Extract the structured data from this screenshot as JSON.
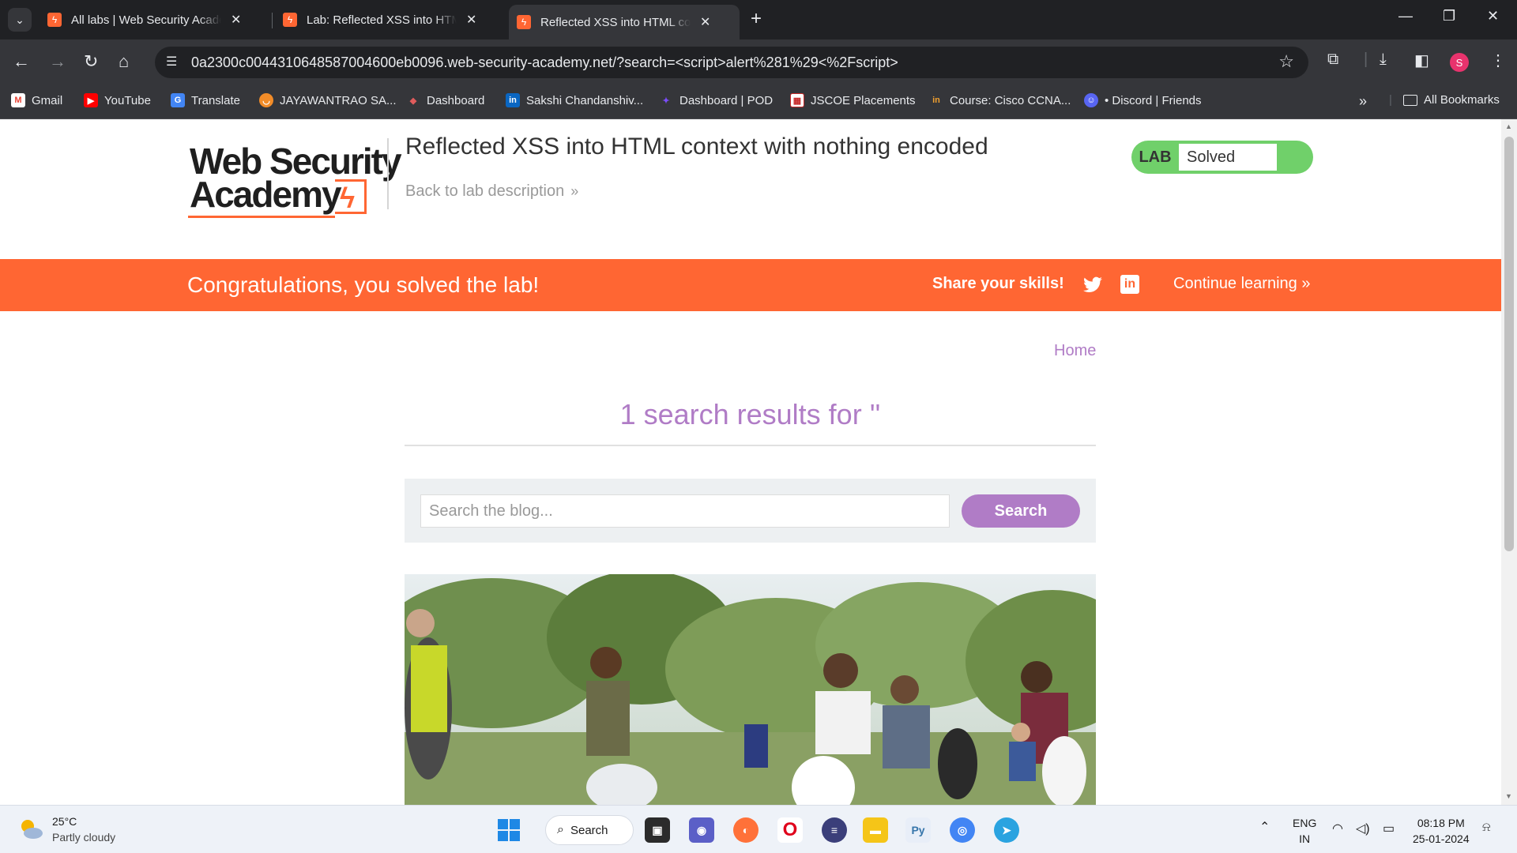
{
  "browser": {
    "tabs": [
      {
        "title": "All labs | Web Security Academy"
      },
      {
        "title": "Lab: Reflected XSS into HTML context with nothing encoded"
      },
      {
        "title": "Reflected XSS into HTML context with nothing encoded",
        "active": true
      }
    ],
    "url": "0a2300c0044310648587004600eb0096.web-security-academy.net/?search=<script>alert%281%29<%2Fscript>",
    "profile_initial": "S",
    "bookmarks": [
      {
        "label": "Gmail"
      },
      {
        "label": "YouTube"
      },
      {
        "label": "Translate"
      },
      {
        "label": "JAYAWANTRAO SA..."
      },
      {
        "label": "Dashboard"
      },
      {
        "label": "Sakshi Chandanshiv..."
      },
      {
        "label": "Dashboard | POD"
      },
      {
        "label": "JSCOE Placements"
      },
      {
        "label": "Course: Cisco CCNA..."
      },
      {
        "label": "• Discord | Friends"
      }
    ],
    "all_bookmarks": "All Bookmarks"
  },
  "header": {
    "logo_line1": "Web Security",
    "logo_line2": "Academy",
    "lab_title": "Reflected XSS into HTML context with nothing encoded",
    "back_link": "Back to lab description",
    "lab_badge_label": "LAB",
    "lab_status": "Solved"
  },
  "banner": {
    "message": "Congratulations, you solved the lab!",
    "share": "Share your skills!",
    "continue": "Continue learning"
  },
  "main": {
    "home_link": "Home",
    "results_title": "1 search results for ''",
    "search_placeholder": "Search the blog...",
    "search_button": "Search"
  },
  "taskbar": {
    "temperature": "25°C",
    "condition": "Partly cloudy",
    "search": "Search",
    "lang_line1": "ENG",
    "lang_line2": "IN",
    "time": "08:18 PM",
    "date": "25-01-2024"
  },
  "colors": {
    "accent_orange": "#ff6633",
    "purple": "#b07cc6",
    "lab_green": "#70d06a"
  }
}
